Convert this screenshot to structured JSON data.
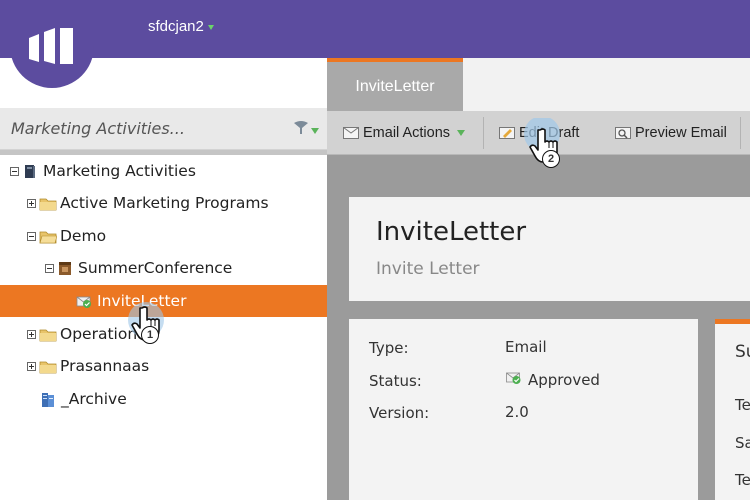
{
  "header": {
    "workspace_name": "sfdcjan2",
    "logo": "marketo-logo-icon"
  },
  "sidebar": {
    "search_placeholder": "Marketing Activities...",
    "filter_icon": "filter-icon",
    "tree": [
      {
        "label": "Marketing Activities",
        "icon": "book-stack-icon",
        "expander": "collapse",
        "level": 0
      },
      {
        "label": "Active Marketing Programs",
        "icon": "folder-icon",
        "expander": "expand",
        "level": 1
      },
      {
        "label": "Demo",
        "icon": "folder-icon",
        "expander": "collapse",
        "level": 1
      },
      {
        "label": "SummerConference",
        "icon": "event-program-icon",
        "expander": "collapse",
        "level": 2
      },
      {
        "label": "InviteLetter",
        "icon": "approved-email-icon",
        "expander": "none",
        "level": 3,
        "selected": true
      },
      {
        "label": "Operational",
        "icon": "folder-icon",
        "expander": "expand",
        "level": 1
      },
      {
        "label": "Prasannaas",
        "icon": "folder-icon",
        "expander": "expand",
        "level": 1
      },
      {
        "label": "_Archive",
        "icon": "archive-icon",
        "expander": "none",
        "level": 1
      }
    ]
  },
  "tabs": [
    {
      "label": "InviteLetter",
      "active": true
    }
  ],
  "toolbar": {
    "email_actions": "Email Actions",
    "edit_draft": "Edit Draft",
    "preview_email": "Preview Email"
  },
  "asset": {
    "title": "InviteLetter",
    "subtitle": "Invite Letter",
    "properties": [
      {
        "label": "Type:",
        "value": "Email"
      },
      {
        "label": "Status:",
        "value": "Approved"
      },
      {
        "label": "Version:",
        "value": "2.0"
      }
    ]
  },
  "side_panel": {
    "heading": "Su",
    "rows": [
      "Te",
      "Sa",
      "Te"
    ]
  },
  "callouts": [
    "1",
    "2"
  ],
  "colors": {
    "header": "#5c4c9f",
    "accent": "#ec7722",
    "approved_green": "#5ab35a"
  }
}
